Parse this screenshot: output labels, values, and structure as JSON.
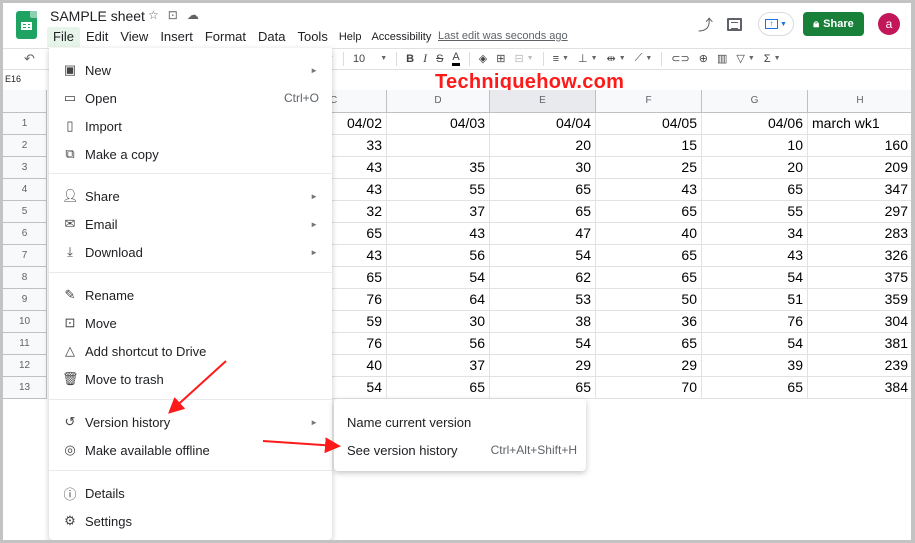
{
  "app": {
    "doc_title": "SAMPLE sheet",
    "title_icons": [
      "star-icon",
      "move-to-folder-icon",
      "cloud-status-icon"
    ],
    "menubar": [
      "File",
      "Edit",
      "View",
      "Insert",
      "Format",
      "Data",
      "Tools",
      "Help",
      "Accessibility"
    ],
    "active_menu": "File",
    "last_edit": "Last edit was seconds ago",
    "share_label": "Share",
    "avatar_initial": "a",
    "colors": {
      "share_green": "#188038",
      "avatar": "#c2185b",
      "accent_blue": "#1a73e8",
      "annotation_red": "#ff1a1a"
    }
  },
  "toolbar": {
    "font_size": "10",
    "bold": "B",
    "italic": "I",
    "strikethrough": "S",
    "text_color": "A",
    "sum": "Σ"
  },
  "name_box": "E16",
  "watermark": "Techniquehow.com",
  "grid": {
    "columns": [
      "C",
      "D",
      "E",
      "F",
      "G",
      "H"
    ],
    "selected_column": "E",
    "rows": [
      {
        "n": "1",
        "cells": [
          "04/02",
          "04/03",
          "04/04",
          "04/05",
          "04/06",
          "march wk1"
        ]
      },
      {
        "n": "2",
        "cells": [
          "33",
          "",
          "20",
          "15",
          "10",
          "160"
        ]
      },
      {
        "n": "3",
        "cells": [
          "43",
          "35",
          "30",
          "25",
          "20",
          "209"
        ]
      },
      {
        "n": "4",
        "cells": [
          "43",
          "55",
          "65",
          "43",
          "65",
          "347"
        ]
      },
      {
        "n": "5",
        "cells": [
          "32",
          "37",
          "65",
          "65",
          "55",
          "297"
        ]
      },
      {
        "n": "6",
        "cells": [
          "65",
          "43",
          "47",
          "40",
          "34",
          "283"
        ]
      },
      {
        "n": "7",
        "cells": [
          "43",
          "56",
          "54",
          "65",
          "43",
          "326"
        ]
      },
      {
        "n": "8",
        "cells": [
          "65",
          "54",
          "62",
          "65",
          "54",
          "375"
        ]
      },
      {
        "n": "9",
        "cells": [
          "76",
          "64",
          "53",
          "50",
          "51",
          "359"
        ]
      },
      {
        "n": "10",
        "cells": [
          "59",
          "30",
          "38",
          "36",
          "76",
          "304"
        ]
      },
      {
        "n": "11",
        "cells": [
          "76",
          "56",
          "54",
          "65",
          "54",
          "381"
        ]
      },
      {
        "n": "12",
        "cells": [
          "40",
          "37",
          "29",
          "29",
          "39",
          "239"
        ]
      },
      {
        "n": "13",
        "cells": [
          "54",
          "65",
          "65",
          "70",
          "65",
          "384"
        ]
      }
    ]
  },
  "file_menu": {
    "items": [
      {
        "label": "New",
        "icon": "new-sheet-icon",
        "submenu": true
      },
      {
        "label": "Open",
        "icon": "folder-icon",
        "shortcut": "Ctrl+O"
      },
      {
        "label": "Import",
        "icon": "file-icon"
      },
      {
        "label": "Make a copy",
        "icon": "copy-icon"
      },
      {
        "label": "Share",
        "icon": "add-person-icon",
        "submenu": true
      },
      {
        "label": "Email",
        "icon": "envelope-icon",
        "submenu": true
      },
      {
        "label": "Download",
        "icon": "download-icon",
        "submenu": true
      },
      {
        "label": "Rename",
        "icon": "pencil-icon"
      },
      {
        "label": "Move",
        "icon": "move-folder-icon"
      },
      {
        "label": "Add shortcut to Drive",
        "icon": "drive-shortcut-icon"
      },
      {
        "label": "Move to trash",
        "icon": "trash-icon"
      },
      {
        "label": "Version history",
        "icon": "history-icon",
        "submenu": true
      },
      {
        "label": "Make available offline",
        "icon": "offline-icon"
      },
      {
        "label": "Details",
        "icon": "info-icon"
      },
      {
        "label": "Settings",
        "icon": "gear-icon"
      }
    ]
  },
  "version_submenu": {
    "items": [
      {
        "label": "Name current version"
      },
      {
        "label": "See version history",
        "shortcut": "Ctrl+Alt+Shift+H"
      }
    ]
  }
}
